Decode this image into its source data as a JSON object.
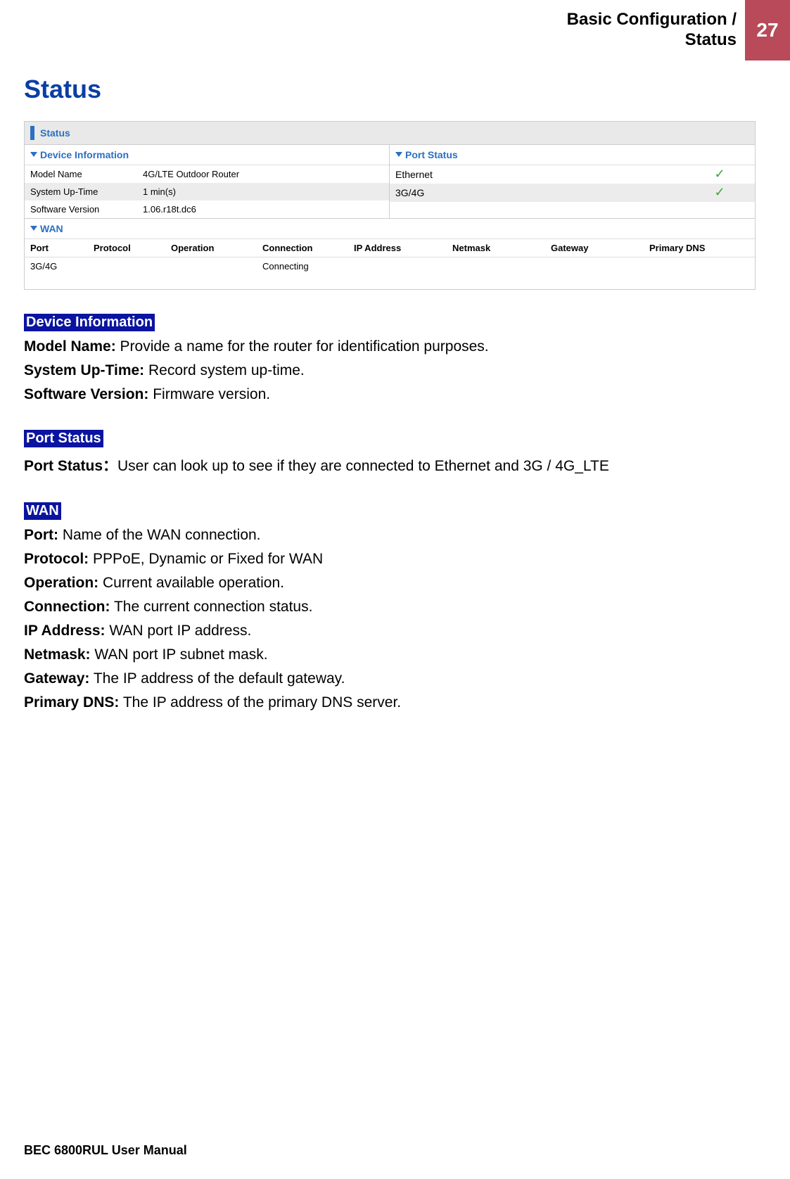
{
  "header": {
    "title_line1": "Basic Configuration /",
    "title_line2": "Status",
    "page_number": "27"
  },
  "main_title": "Status",
  "screenshot": {
    "status_label": "Status",
    "device_info": {
      "title": "Device Information",
      "rows": [
        {
          "label": "Model Name",
          "value": "4G/LTE Outdoor Router"
        },
        {
          "label": "System Up-Time",
          "value": "1 min(s)"
        },
        {
          "label": "Software Version",
          "value": "1.06.r18t.dc6"
        }
      ]
    },
    "port_status": {
      "title": "Port Status",
      "rows": [
        {
          "label": "Ethernet",
          "check": "✓"
        },
        {
          "label": "3G/4G",
          "check": "✓"
        }
      ]
    },
    "wan": {
      "title": "WAN",
      "headers": [
        "Port",
        "Protocol",
        "Operation",
        "Connection",
        "IP Address",
        "Netmask",
        "Gateway",
        "Primary DNS"
      ],
      "row": {
        "port": "3G/4G",
        "protocol": "",
        "operation": "",
        "connection": "Connecting",
        "ip": "",
        "netmask": "",
        "gateway": "",
        "dns": ""
      }
    }
  },
  "sections": {
    "device_info_head": "Device Information",
    "device_info_items": [
      {
        "label": "Model Name:",
        "text": " Provide a name for the router for identification purposes."
      },
      {
        "label": "System Up-Time:",
        "text": " Record system up-time."
      },
      {
        "label": "Software Version:",
        "text": " Firmware version."
      }
    ],
    "port_status_head": "Port Status",
    "port_status_items": [
      {
        "label": "Port Status：",
        "text": "User can look up to see if they are connected to Ethernet and 3G / 4G_LTE"
      }
    ],
    "wan_head": "WAN",
    "wan_items": [
      {
        "label": "Port:",
        "text": " Name of the WAN connection."
      },
      {
        "label": "Protocol:",
        "text": " PPPoE, Dynamic or Fixed for WAN"
      },
      {
        "label": "Operation:",
        "text": " Current available operation."
      },
      {
        "label": "Connection:",
        "text": " The current connection status."
      },
      {
        "label": "IP Address:",
        "text": " WAN port IP address."
      },
      {
        "label": "Netmask:",
        "text": " WAN port IP subnet mask."
      },
      {
        "label": "Gateway:",
        "text": " The IP address of the default gateway."
      },
      {
        "label": "Primary DNS:",
        "text": " The IP address of the primary DNS server."
      }
    ]
  },
  "footer": "BEC 6800RUL User Manual"
}
